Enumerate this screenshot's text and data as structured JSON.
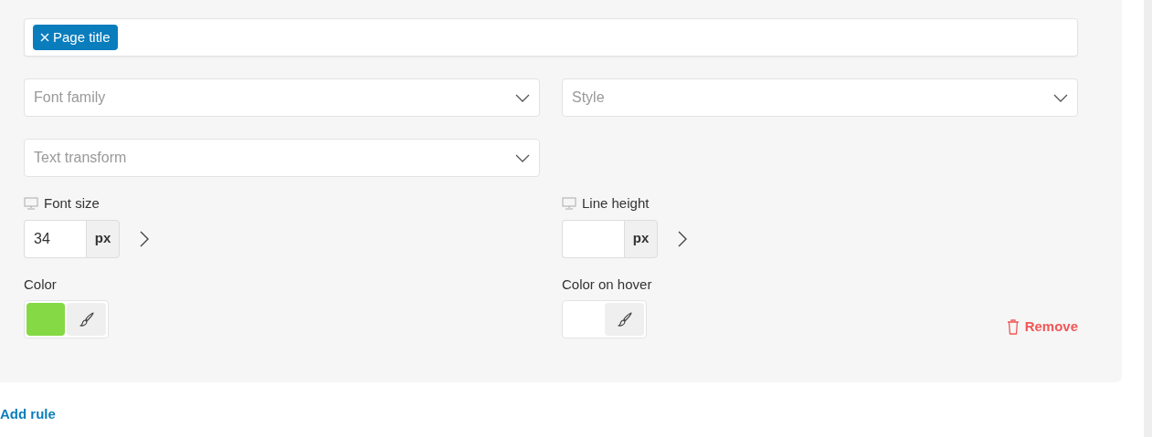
{
  "tags": [
    {
      "label": "Page title"
    }
  ],
  "selects": [
    {
      "placeholder": "Font family"
    },
    {
      "placeholder": "Style"
    },
    {
      "placeholder": "Text transform"
    }
  ],
  "size_fields": [
    {
      "label": "Font size",
      "value": "34",
      "unit": "px"
    },
    {
      "label": "Line height",
      "unit": "px"
    }
  ],
  "color_fields": [
    {
      "label": "Color",
      "color": "#84d944"
    },
    {
      "label": "Color on hover"
    }
  ],
  "remove_button": {
    "label": "Remove"
  },
  "add_rule": {
    "label": "Add rule"
  }
}
